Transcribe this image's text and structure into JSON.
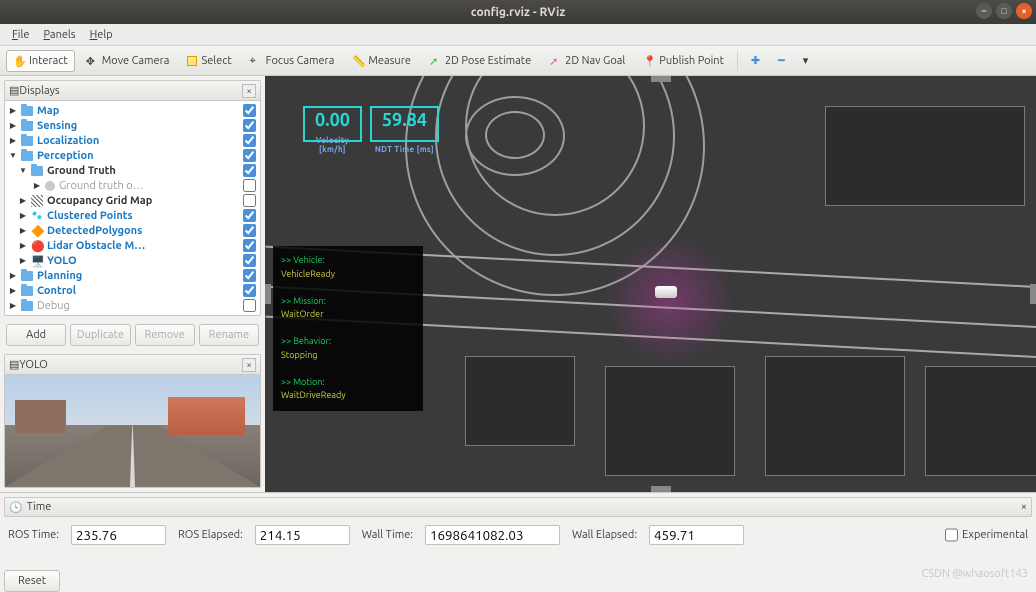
{
  "window": {
    "title": "config.rviz - RViz"
  },
  "menu": {
    "items": [
      "File",
      "Panels",
      "Help"
    ]
  },
  "toolbar": {
    "interact": "Interact",
    "move_camera": "Move Camera",
    "select": "Select",
    "focus_camera": "Focus Camera",
    "measure": "Measure",
    "pose_estimate": "2D Pose Estimate",
    "nav_goal": "2D Nav Goal",
    "publish_point": "Publish Point"
  },
  "displays": {
    "title": "Displays",
    "items": [
      {
        "label": "Map",
        "kind": "folder",
        "link": true,
        "depth": 0,
        "arrow": "right",
        "checked": true
      },
      {
        "label": "Sensing",
        "kind": "folder",
        "link": true,
        "depth": 0,
        "arrow": "right",
        "checked": true
      },
      {
        "label": "Localization",
        "kind": "folder",
        "link": true,
        "depth": 0,
        "arrow": "right",
        "checked": true
      },
      {
        "label": "Perception",
        "kind": "folder",
        "link": true,
        "depth": 0,
        "arrow": "down",
        "checked": true
      },
      {
        "label": "Ground Truth",
        "kind": "folder",
        "link": false,
        "depth": 1,
        "arrow": "down",
        "checked": true
      },
      {
        "label": "Ground truth o…",
        "kind": "dot",
        "link": false,
        "muted": true,
        "depth": 2,
        "arrow": "right",
        "checked": false
      },
      {
        "label": "Occupancy Grid Map",
        "kind": "grid",
        "link": false,
        "depth": 1,
        "arrow": "right",
        "checked": false
      },
      {
        "label": "Clustered Points",
        "kind": "pts",
        "link": true,
        "depth": 1,
        "arrow": "right",
        "checked": true
      },
      {
        "label": "DetectedPolygons",
        "kind": "poly",
        "link": true,
        "depth": 1,
        "arrow": "right",
        "checked": true
      },
      {
        "label": "Lidar Obstacle M…",
        "kind": "lidar",
        "link": true,
        "depth": 1,
        "arrow": "right",
        "checked": true
      },
      {
        "label": "YOLO",
        "kind": "yolo",
        "link": true,
        "depth": 1,
        "arrow": "right",
        "checked": true
      },
      {
        "label": "Planning",
        "kind": "folder",
        "link": true,
        "depth": 0,
        "arrow": "right",
        "checked": true
      },
      {
        "label": "Control",
        "kind": "folder",
        "link": true,
        "depth": 0,
        "arrow": "right",
        "checked": true
      },
      {
        "label": "Debug",
        "kind": "folder",
        "link": false,
        "muted": true,
        "depth": 0,
        "arrow": "right",
        "checked": false
      }
    ],
    "buttons": {
      "add": "Add",
      "duplicate": "Duplicate",
      "remove": "Remove",
      "rename": "Rename"
    }
  },
  "yolo_panel": {
    "title": "YOLO"
  },
  "hud": {
    "velocity": {
      "value": "0.00",
      "label": "Velocity [km/h]"
    },
    "ndt": {
      "value": "59.84",
      "label": "NDT Time [ms]"
    }
  },
  "status": {
    "vehicle_h": ">> Vehicle:",
    "vehicle_v": "VehicleReady",
    "mission_h": ">> Mission:",
    "mission_v": "WaitOrder",
    "behavior_h": ">> Behavior:",
    "behavior_v": "Stopping",
    "motion_h": ">> Motion:",
    "motion_v": "WaitDriveReady"
  },
  "time": {
    "title": "Time",
    "ros_time_l": "ROS Time:",
    "ros_time_v": "235.76",
    "ros_elapsed_l": "ROS Elapsed:",
    "ros_elapsed_v": "214.15",
    "wall_time_l": "Wall Time:",
    "wall_time_v": "1698641082.03",
    "wall_elapsed_l": "Wall Elapsed:",
    "wall_elapsed_v": "459.71",
    "experimental": "Experimental",
    "reset": "Reset"
  },
  "watermark": "CSDN @whaosoft143"
}
